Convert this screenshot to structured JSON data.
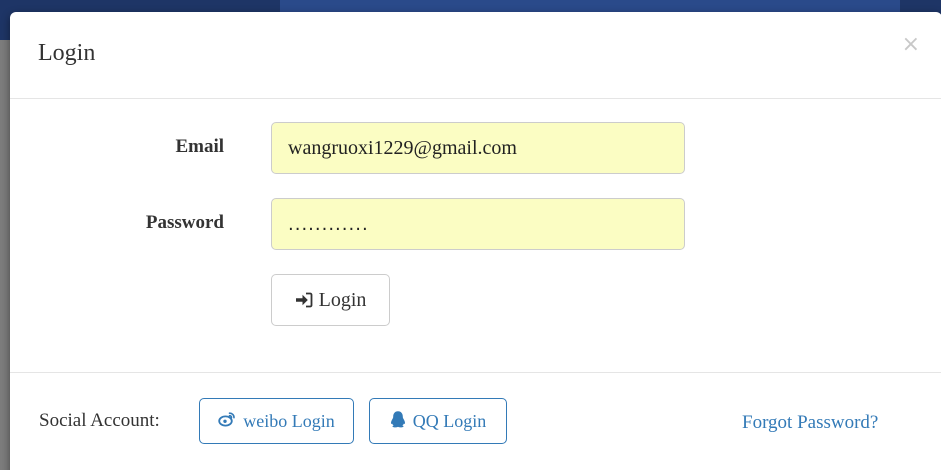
{
  "modal": {
    "title": "Login",
    "close_label": "×"
  },
  "form": {
    "email_label": "Email",
    "email_value": "wangruoxi1229@gmail.com",
    "password_label": "Password",
    "password_value": "............",
    "login_button_label": "Login"
  },
  "footer": {
    "social_label": "Social Account:",
    "weibo_button_label": "weibo Login",
    "qq_button_label": "QQ Login",
    "forgot_link": "Forgot Password?"
  },
  "icons": {
    "login": "sign-in-icon",
    "weibo": "weibo-icon",
    "qq": "qq-icon",
    "close": "close-icon"
  },
  "colors": {
    "link": "#337ab7",
    "autofill_background": "#fbfdc3",
    "backdrop": "#7d7d7d",
    "navbar": "#1e3566"
  }
}
